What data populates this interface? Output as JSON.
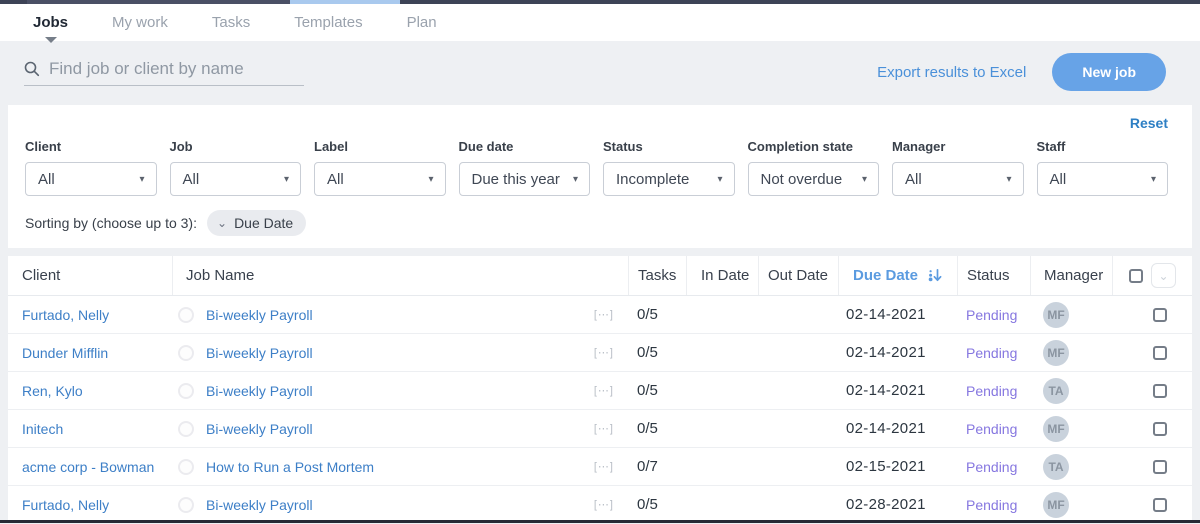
{
  "icons": {
    "dropdown_caret": "▾",
    "chevron_down": "⌄",
    "meatball": "[⋯]"
  },
  "colors": {
    "accent_blue": "#67a3e7",
    "link_blue": "#3d7fc7",
    "reset_blue": "#2d7fc4",
    "sorted_header_blue": "#5b9be0",
    "status_pending_purple": "#8677e0",
    "avatar_gray": "#c9d2dc",
    "topbar_dark": "#3d4356"
  },
  "nav": {
    "tabs": [
      {
        "label": "Jobs",
        "active": true
      },
      {
        "label": "My work",
        "active": false
      },
      {
        "label": "Tasks",
        "active": false
      },
      {
        "label": "Templates",
        "active": false
      },
      {
        "label": "Plan",
        "active": false
      }
    ]
  },
  "toolbar": {
    "search_placeholder": "Find job or client by name",
    "export_label": "Export results to Excel",
    "new_job_label": "New job"
  },
  "filters": {
    "reset_label": "Reset",
    "fields": [
      {
        "label": "Client",
        "value": "All"
      },
      {
        "label": "Job",
        "value": "All"
      },
      {
        "label": "Label",
        "value": "All"
      },
      {
        "label": "Due date",
        "value": "Due this year"
      },
      {
        "label": "Status",
        "value": "Incomplete"
      },
      {
        "label": "Completion state",
        "value": "Not overdue"
      },
      {
        "label": "Manager",
        "value": "All"
      },
      {
        "label": "Staff",
        "value": "All"
      }
    ]
  },
  "sorting": {
    "label": "Sorting by (choose up to 3):",
    "chips": [
      {
        "label": "Due Date"
      }
    ]
  },
  "table": {
    "columns": {
      "client": "Client",
      "job_name": "Job Name",
      "tasks": "Tasks",
      "in_date": "In Date",
      "out_date": "Out Date",
      "due_date": "Due Date",
      "status": "Status",
      "manager": "Manager"
    },
    "sorted_column": "Due Date",
    "rows": [
      {
        "client": "Furtado, Nelly",
        "job": "Bi-weekly Payroll",
        "tasks": "0/5",
        "in_date": "",
        "out_date": "",
        "due_date": "02-14-2021",
        "status": "Pending",
        "manager": "MF"
      },
      {
        "client": "Dunder Mifflin",
        "job": "Bi-weekly Payroll",
        "tasks": "0/5",
        "in_date": "",
        "out_date": "",
        "due_date": "02-14-2021",
        "status": "Pending",
        "manager": "MF"
      },
      {
        "client": "Ren, Kylo",
        "job": "Bi-weekly Payroll",
        "tasks": "0/5",
        "in_date": "",
        "out_date": "",
        "due_date": "02-14-2021",
        "status": "Pending",
        "manager": "TA"
      },
      {
        "client": "Initech",
        "job": "Bi-weekly Payroll",
        "tasks": "0/5",
        "in_date": "",
        "out_date": "",
        "due_date": "02-14-2021",
        "status": "Pending",
        "manager": "MF"
      },
      {
        "client": "acme corp - Bowman",
        "job": "How to Run a Post Mortem",
        "tasks": "0/7",
        "in_date": "",
        "out_date": "",
        "due_date": "02-15-2021",
        "status": "Pending",
        "manager": "TA"
      },
      {
        "client": "Furtado, Nelly",
        "job": "Bi-weekly Payroll",
        "tasks": "0/5",
        "in_date": "",
        "out_date": "",
        "due_date": "02-28-2021",
        "status": "Pending",
        "manager": "MF"
      }
    ]
  }
}
